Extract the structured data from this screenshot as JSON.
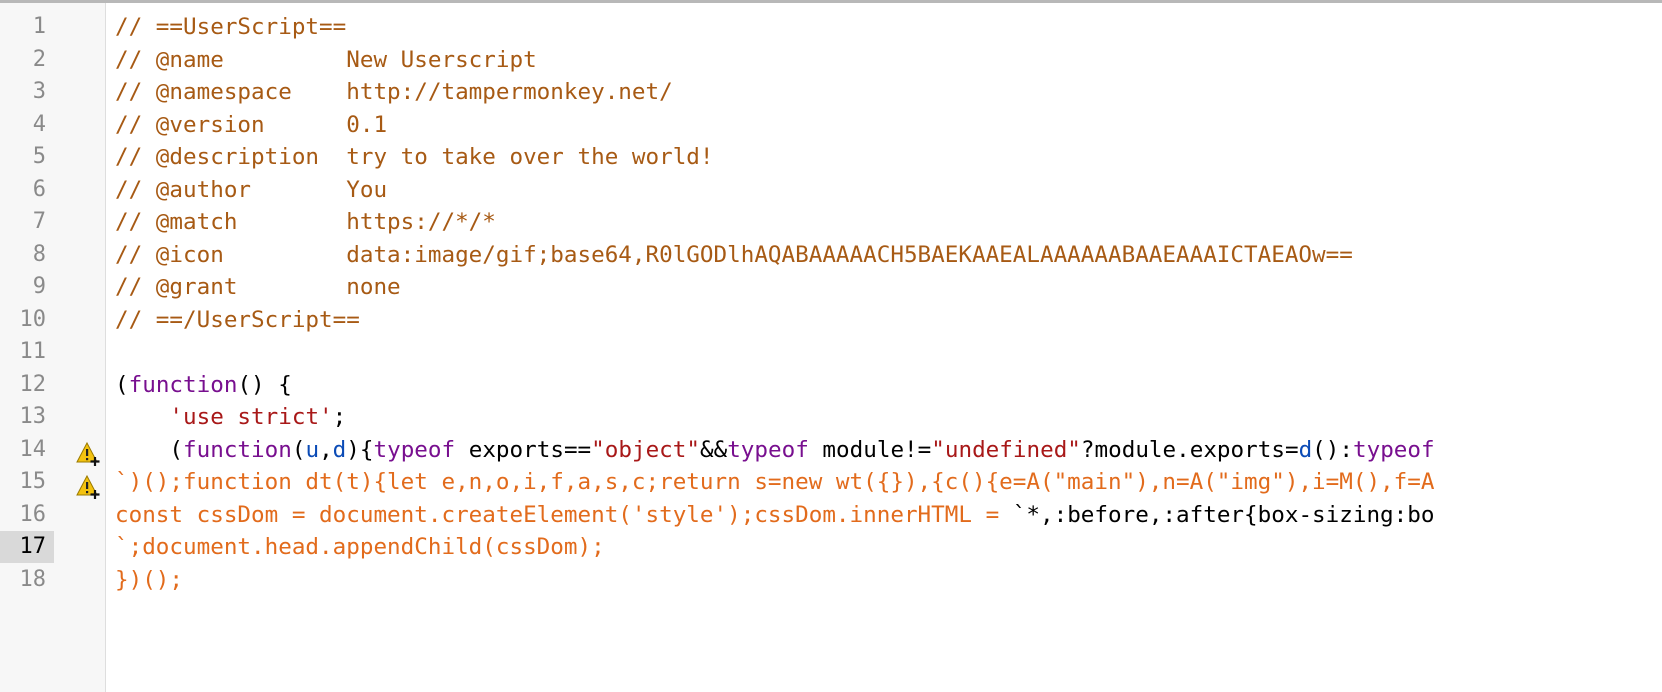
{
  "editor": {
    "active_line": 17,
    "lines": [
      {
        "num": "1",
        "text": "// ==UserScript=="
      },
      {
        "num": "2",
        "text": "// @name         New Userscript"
      },
      {
        "num": "3",
        "text": "// @namespace    http://tampermonkey.net/"
      },
      {
        "num": "4",
        "text": "// @version      0.1"
      },
      {
        "num": "5",
        "text": "// @description  try to take over the world!"
      },
      {
        "num": "6",
        "text": "// @author       You"
      },
      {
        "num": "7",
        "text": "// @match        https://*/*"
      },
      {
        "num": "8",
        "text": "// @icon         data:image/gif;base64,R0lGODlhAQABAAAAACH5BAEKAAEALAAAAAABAAEAAAICTAEAOw=="
      },
      {
        "num": "9",
        "text": "// @grant        none"
      },
      {
        "num": "10",
        "text": "// ==/UserScript=="
      },
      {
        "num": "11",
        "text": ""
      },
      {
        "num": "12",
        "tokens": [
          "(",
          "function",
          "() {"
        ]
      },
      {
        "num": "13",
        "tokens": [
          "    ",
          "'use strict'",
          ";"
        ]
      },
      {
        "num": "14",
        "warning": true,
        "tokens": [
          "    (",
          "function",
          "(",
          "u",
          ",",
          "d",
          "){",
          "typeof",
          " exports==",
          "\"object\"",
          "&&",
          "typeof",
          " module!=",
          "\"undefined\"",
          "?module.exports=",
          "d",
          "():",
          "typeof"
        ]
      },
      {
        "num": "15",
        "warning": true,
        "text": "`)();function dt(t){let e,n,o,i,f,a,s,c;return s=new wt({}),{c(){e=A(\"main\"),n=A(\"img\"),i=M(),f=A"
      },
      {
        "num": "16",
        "tokens": [
          "const cssDom = document.createElement('style');cssDom.innerHTML = ",
          "`",
          "*,:before,:after{box-sizing:bo"
        ]
      },
      {
        "num": "17",
        "text": "`;document.head.appendChild(cssDom);"
      },
      {
        "num": "18",
        "text": "})();"
      }
    ]
  },
  "colors": {
    "comment": "#a75a14",
    "keyword": "#780f8f",
    "variable": "#0b4bb6",
    "string": "#a81818",
    "template": "#e26b1c",
    "warning": "#f3c20f"
  },
  "icons": {
    "warning": "warning-icon"
  }
}
